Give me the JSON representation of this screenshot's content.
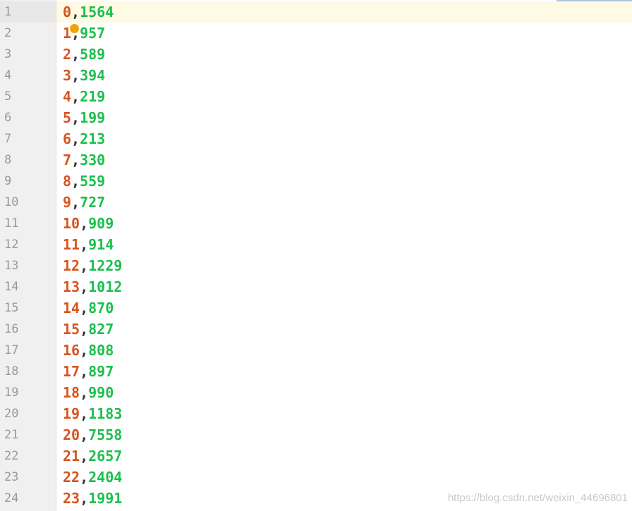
{
  "editor": {
    "current_line": 1,
    "rows": [
      {
        "line": "1",
        "key": "0",
        "sep": ",",
        "value": "1564"
      },
      {
        "line": "2",
        "key": "1",
        "sep": ",",
        "value": "957"
      },
      {
        "line": "3",
        "key": "2",
        "sep": ",",
        "value": "589"
      },
      {
        "line": "4",
        "key": "3",
        "sep": ",",
        "value": "394"
      },
      {
        "line": "5",
        "key": "4",
        "sep": ",",
        "value": "219"
      },
      {
        "line": "6",
        "key": "5",
        "sep": ",",
        "value": "199"
      },
      {
        "line": "7",
        "key": "6",
        "sep": ",",
        "value": "213"
      },
      {
        "line": "8",
        "key": "7",
        "sep": ",",
        "value": "330"
      },
      {
        "line": "9",
        "key": "8",
        "sep": ",",
        "value": "559"
      },
      {
        "line": "10",
        "key": "9",
        "sep": ",",
        "value": "727"
      },
      {
        "line": "11",
        "key": "10",
        "sep": ",",
        "value": "909"
      },
      {
        "line": "12",
        "key": "11",
        "sep": ",",
        "value": "914"
      },
      {
        "line": "13",
        "key": "12",
        "sep": ",",
        "value": "1229"
      },
      {
        "line": "14",
        "key": "13",
        "sep": ",",
        "value": "1012"
      },
      {
        "line": "15",
        "key": "14",
        "sep": ",",
        "value": "870"
      },
      {
        "line": "16",
        "key": "15",
        "sep": ",",
        "value": "827"
      },
      {
        "line": "17",
        "key": "16",
        "sep": ",",
        "value": "808"
      },
      {
        "line": "18",
        "key": "17",
        "sep": ",",
        "value": "897"
      },
      {
        "line": "19",
        "key": "18",
        "sep": ",",
        "value": "990"
      },
      {
        "line": "20",
        "key": "19",
        "sep": ",",
        "value": "1183"
      },
      {
        "line": "21",
        "key": "20",
        "sep": ",",
        "value": "7558"
      },
      {
        "line": "22",
        "key": "21",
        "sep": ",",
        "value": "2657"
      },
      {
        "line": "23",
        "key": "22",
        "sep": ",",
        "value": "2404"
      },
      {
        "line": "24",
        "key": "23",
        "sep": ",",
        "value": "1991"
      }
    ],
    "intention_icon": "lightbulb-icon"
  },
  "colors": {
    "key": "#d9531e",
    "value": "#1cbf4e",
    "separator": "#333333",
    "line_number": "#999999",
    "current_line_bg": "#fffae3",
    "gutter_bg": "#f0f0f0"
  },
  "watermark": "https://blog.csdn.net/weixin_44696801"
}
